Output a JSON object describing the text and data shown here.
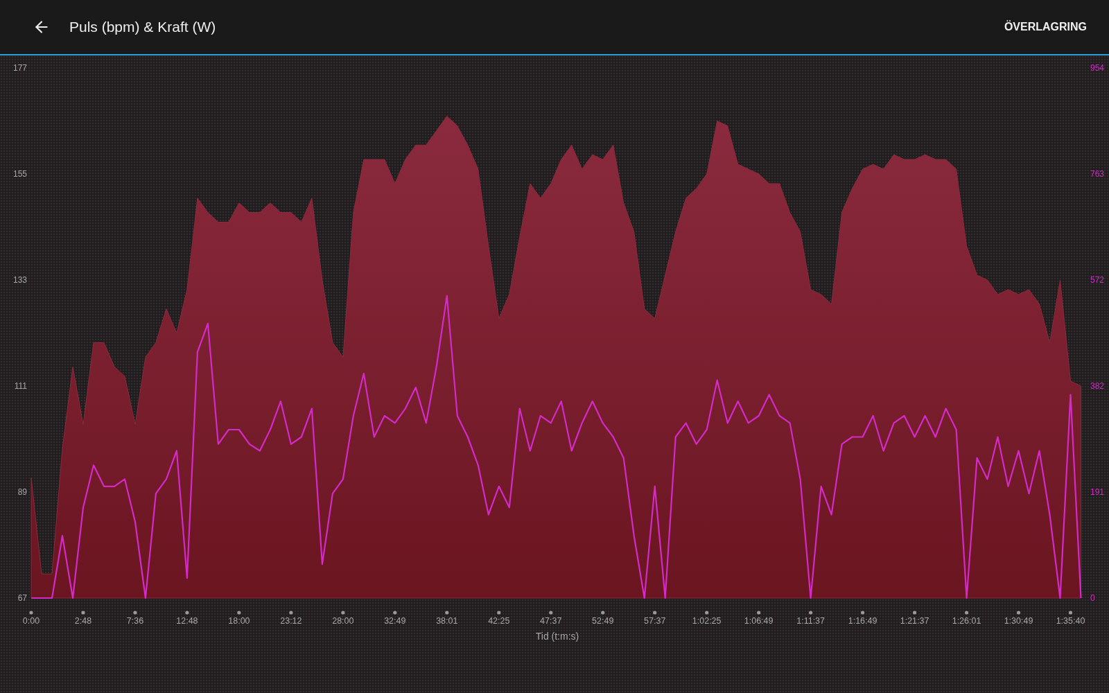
{
  "header": {
    "title": "Puls (bpm) & Kraft (W)",
    "action": "ÖVERLAGRING"
  },
  "chart": {
    "chart_data": {
      "type": "area",
      "xlabel": "Tid (t:m:s)",
      "categories": [
        "0:00",
        null,
        null,
        null,
        null,
        "2:48",
        null,
        null,
        null,
        null,
        "7:36",
        null,
        null,
        null,
        null,
        "12:48",
        null,
        null,
        null,
        null,
        "18:00",
        null,
        null,
        null,
        null,
        "23:12",
        null,
        null,
        null,
        null,
        "28:00",
        null,
        null,
        null,
        null,
        "32:49",
        null,
        null,
        null,
        null,
        "38:01",
        null,
        null,
        null,
        null,
        "42:25",
        null,
        null,
        null,
        null,
        "47:37",
        null,
        null,
        null,
        null,
        "52:49",
        null,
        null,
        null,
        null,
        "57:37",
        null,
        null,
        null,
        null,
        "1:02:25",
        null,
        null,
        null,
        null,
        "1:06:49",
        null,
        null,
        null,
        null,
        "1:11:37",
        null,
        null,
        null,
        null,
        "1:16:49",
        null,
        null,
        null,
        null,
        "1:21:37",
        null,
        null,
        null,
        null,
        "1:26:01",
        null,
        null,
        null,
        null,
        "1:30:49",
        null,
        null,
        null,
        null,
        "1:35:40",
        null
      ],
      "ylim": [
        67,
        177
      ],
      "yticks": [
        67,
        89,
        111,
        133,
        155,
        177
      ],
      "y2lim": [
        0,
        954
      ],
      "y2ticks": [
        0,
        191,
        382,
        572,
        763,
        954
      ],
      "series": [
        {
          "color": "#8b2a3e",
          "values": [
            92,
            72,
            72,
            98,
            115,
            103,
            120,
            120,
            115,
            113,
            103,
            117,
            120,
            127,
            122,
            131,
            150,
            147,
            145,
            145,
            149,
            147,
            147,
            149,
            147,
            147,
            145,
            150,
            133,
            120,
            117,
            147,
            158,
            158,
            158,
            153,
            158,
            161,
            161,
            164,
            167,
            165,
            161,
            156,
            140,
            125,
            130,
            142,
            153,
            150,
            153,
            158,
            161,
            156,
            159,
            158,
            161,
            149,
            143,
            127,
            125,
            134,
            143,
            150,
            152,
            155,
            166,
            165,
            157,
            156,
            155,
            153,
            153,
            147,
            143,
            131,
            130,
            128,
            147,
            152,
            156,
            157,
            156,
            159,
            158,
            158,
            159,
            158,
            158,
            156,
            140,
            134,
            133,
            130,
            131,
            130,
            131,
            128,
            120,
            133,
            112,
            111
          ]
        },
        {
          "color": "#d42ac8",
          "axis": "y2",
          "type": "line",
          "values": [
            0,
            0,
            0,
            112,
            0,
            163,
            239,
            201,
            201,
            214,
            137,
            0,
            188,
            214,
            265,
            36,
            443,
            494,
            277,
            303,
            303,
            277,
            265,
            303,
            354,
            277,
            290,
            341,
            61,
            188,
            214,
            328,
            404,
            290,
            328,
            315,
            341,
            379,
            315,
            417,
            544,
            328,
            290,
            239,
            150,
            201,
            163,
            341,
            265,
            328,
            315,
            354,
            265,
            315,
            354,
            315,
            290,
            252,
            112,
            0,
            201,
            0,
            290,
            315,
            277,
            303,
            392,
            315,
            354,
            315,
            328,
            366,
            328,
            315,
            214,
            0,
            201,
            150,
            277,
            290,
            290,
            328,
            265,
            315,
            328,
            290,
            328,
            290,
            341,
            303,
            0,
            252,
            214,
            290,
            201,
            265,
            188,
            265,
            150,
            0,
            366,
            0
          ]
        }
      ]
    }
  }
}
